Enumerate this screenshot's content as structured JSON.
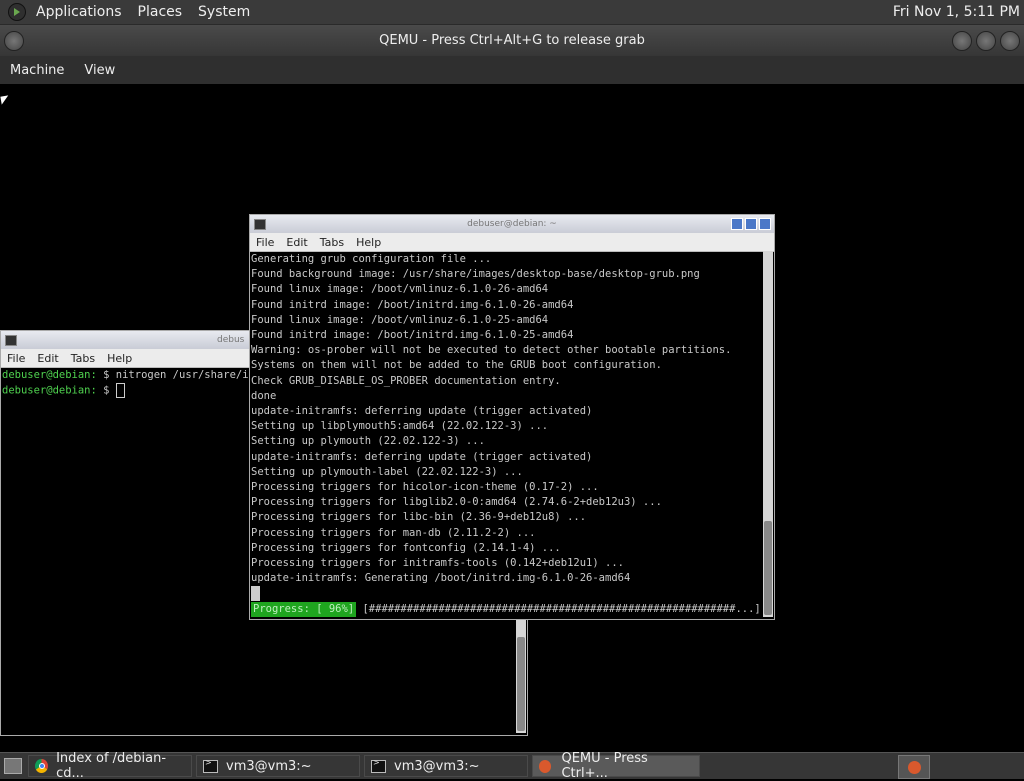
{
  "top_panel": {
    "menus": [
      "Applications",
      "Places",
      "System"
    ],
    "clock": "Fri Nov 1,  5:11 PM"
  },
  "qemu": {
    "title": "QEMU - Press Ctrl+Alt+G to release grab",
    "menu": [
      "Machine",
      "View"
    ]
  },
  "term_back": {
    "title": "debus",
    "menu": [
      "File",
      "Edit",
      "Tabs",
      "Help"
    ],
    "line1_prompt": "debuser@debian:",
    "line1_rest": " $ nitrogen /usr/share/i",
    "line2_prompt": "debuser@debian:",
    "line2_rest": " $ "
  },
  "term_front": {
    "title": "debuser@debian: ~",
    "menu": [
      "File",
      "Edit",
      "Tabs",
      "Help"
    ],
    "lines": [
      "Generating grub configuration file ...",
      "Found background image: /usr/share/images/desktop-base/desktop-grub.png",
      "Found linux image: /boot/vmlinuz-6.1.0-26-amd64",
      "Found initrd image: /boot/initrd.img-6.1.0-26-amd64",
      "Found linux image: /boot/vmlinuz-6.1.0-25-amd64",
      "Found initrd image: /boot/initrd.img-6.1.0-25-amd64",
      "Warning: os-prober will not be executed to detect other bootable partitions.",
      "Systems on them will not be added to the GRUB boot configuration.",
      "Check GRUB_DISABLE_OS_PROBER documentation entry.",
      "done",
      "update-initramfs: deferring update (trigger activated)",
      "Setting up libplymouth5:amd64 (22.02.122-3) ...",
      "Setting up plymouth (22.02.122-3) ...",
      "update-initramfs: deferring update (trigger activated)",
      "Setting up plymouth-label (22.02.122-3) ...",
      "Processing triggers for hicolor-icon-theme (0.17-2) ...",
      "Processing triggers for libglib2.0-0:amd64 (2.74.6-2+deb12u3) ...",
      "Processing triggers for libc-bin (2.36-9+deb12u8) ...",
      "Processing triggers for man-db (2.11.2-2) ...",
      "Processing triggers for fontconfig (2.14.1-4) ...",
      "Processing triggers for initramfs-tools (0.142+deb12u1) ...",
      "update-initramfs: Generating /boot/initrd.img-6.1.0-26-amd64"
    ],
    "progress_label": "Progress: [ 96%]",
    "progress_bar": " [##########################################################...]"
  },
  "taskbar": {
    "items": [
      "Index of /debian-cd...",
      "vm3@vm3:~",
      "vm3@vm3:~",
      "QEMU - Press Ctrl+..."
    ]
  }
}
